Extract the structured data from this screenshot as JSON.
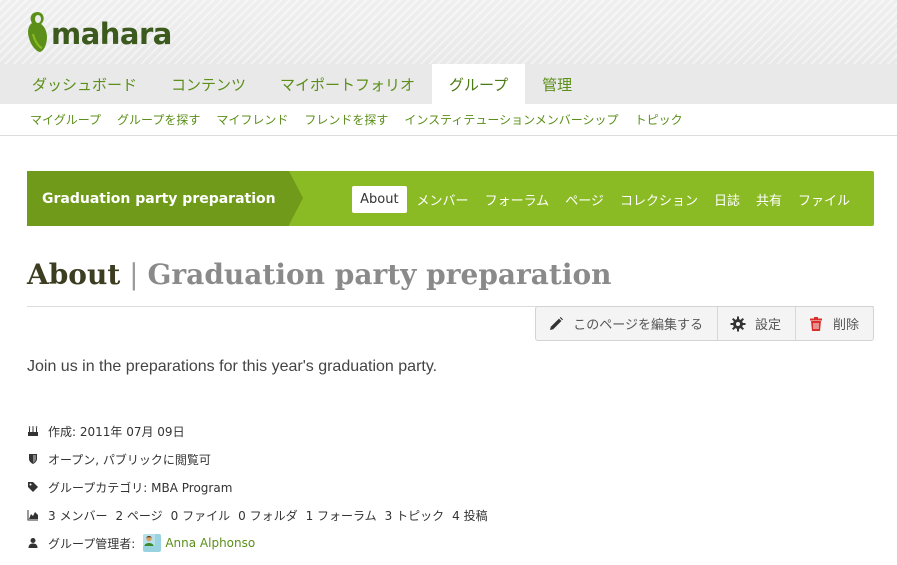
{
  "site": {
    "logo_text": "mahara"
  },
  "main_nav": [
    {
      "label": "ダッシュボード",
      "active": false
    },
    {
      "label": "コンテンツ",
      "active": false
    },
    {
      "label": "マイポートフォリオ",
      "active": false
    },
    {
      "label": "グループ",
      "active": true
    },
    {
      "label": "管理",
      "active": false
    }
  ],
  "sub_nav": [
    "マイグループ",
    "グループを探す",
    "マイフレンド",
    "フレンドを探す",
    "インスティテューションメンバーシップ",
    "トピック"
  ],
  "group": {
    "name": "Graduation party preparation",
    "tabs": [
      {
        "label": "About",
        "active": true
      },
      {
        "label": "メンバー",
        "active": false
      },
      {
        "label": "フォーラム",
        "active": false
      },
      {
        "label": "ページ",
        "active": false
      },
      {
        "label": "コレクション",
        "active": false
      },
      {
        "label": "日誌",
        "active": false
      },
      {
        "label": "共有",
        "active": false
      },
      {
        "label": "ファイル",
        "active": false
      }
    ]
  },
  "heading": {
    "main": "About",
    "separator": " | ",
    "sub": "Graduation party preparation"
  },
  "actions": {
    "edit": "このページを編集する",
    "settings": "設定",
    "delete": "削除"
  },
  "description": "Join us in the preparations for this year's graduation party.",
  "info": {
    "created": "作成: 2011年 07月 09日",
    "visibility": "オープン, パブリックに閲覧可",
    "category": "グループカテゴリ: MBA Program",
    "stats": [
      "3 メンバー",
      "2 ページ",
      "0 ファイル",
      "0 フォルダ",
      "1 フォーラム",
      "3 トピック",
      "4 投稿"
    ],
    "admin_label": "グループ管理者:",
    "admin_name": "Anna Alphonso"
  },
  "colors": {
    "brand_green": "#8bbb24",
    "dark_green": "#6f9a1a",
    "link_green": "#5b8f19",
    "delete_red": "#d9302c"
  }
}
